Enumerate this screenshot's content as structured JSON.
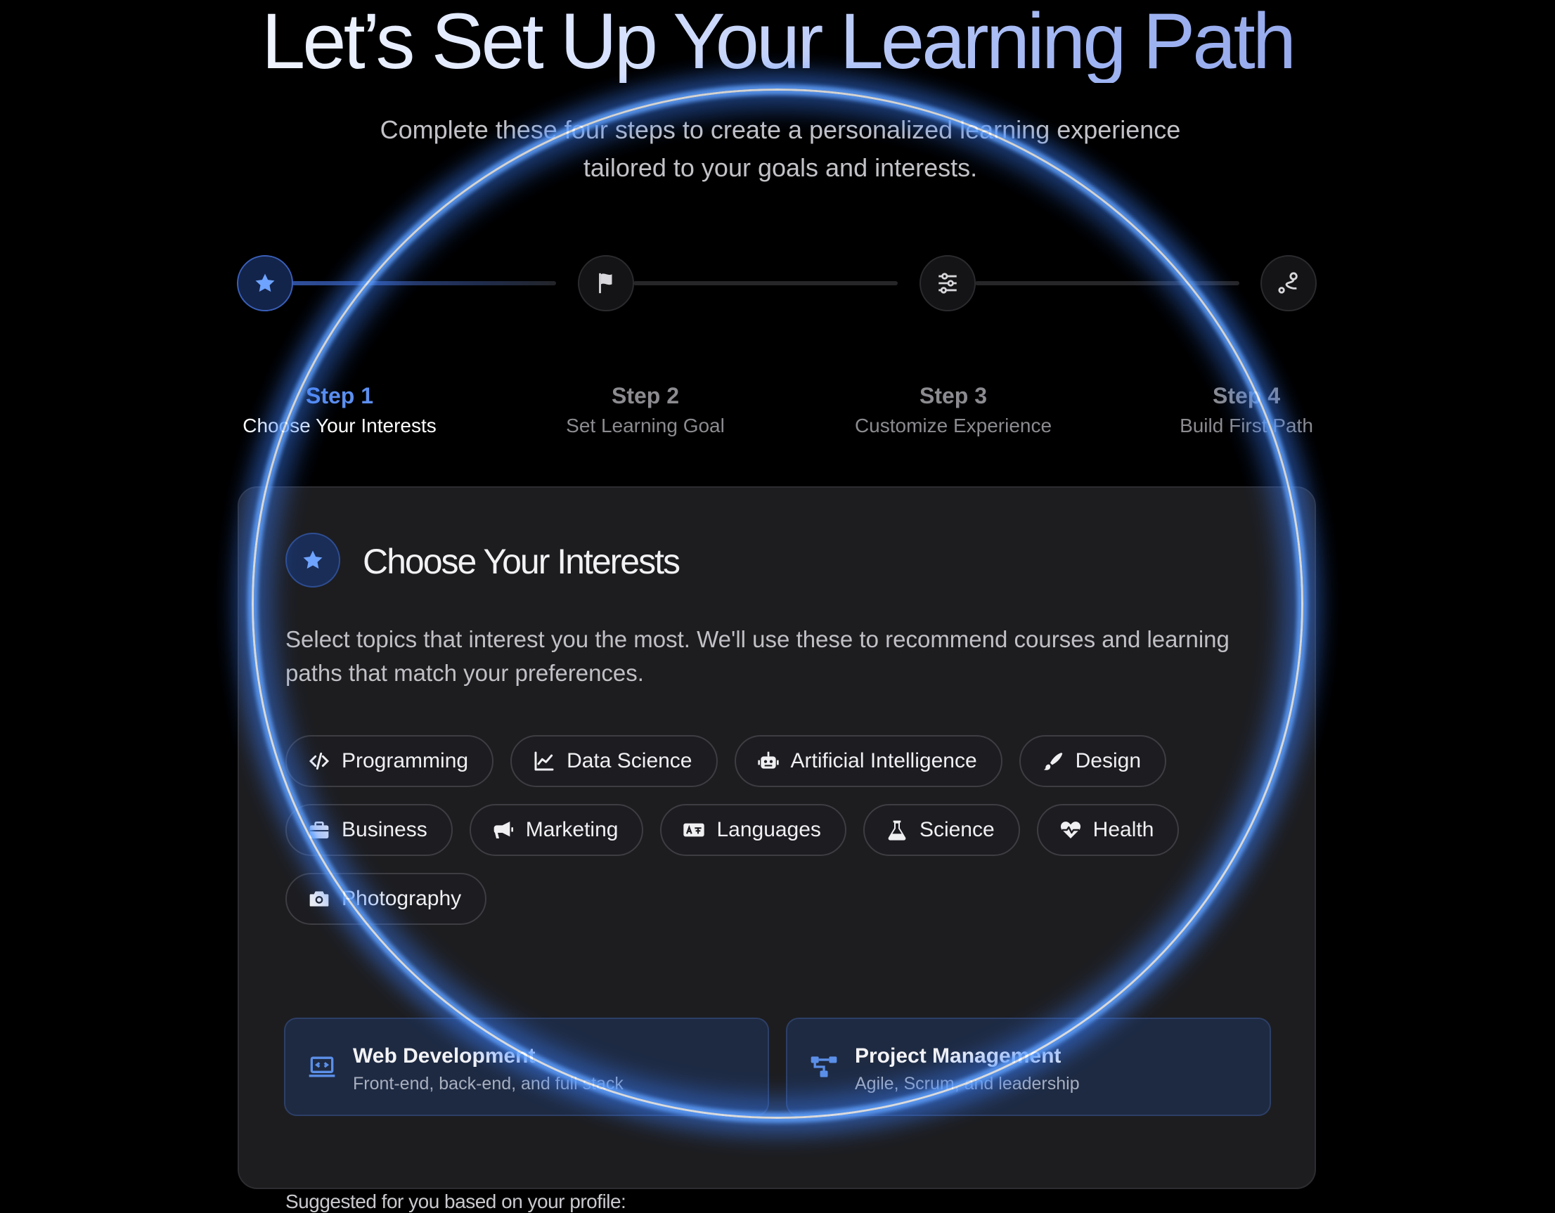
{
  "header": {
    "title": "Let’s Set Up Your Learning Path",
    "subtitle_line1": "Complete these four steps to create a personalized learning experience",
    "subtitle_line2": "tailored to your goals and interests."
  },
  "stepper": {
    "active_step": 1,
    "steps": [
      {
        "label": "Step 1",
        "sub": "Choose Your Interests",
        "icon": "star-icon"
      },
      {
        "label": "Step 2",
        "sub": "Set Learning Goal",
        "icon": "flag-icon"
      },
      {
        "label": "Step 3",
        "sub": "Customize Experience",
        "icon": "sliders-icon"
      },
      {
        "label": "Step 4",
        "sub": "Build First Path",
        "icon": "route-icon"
      }
    ]
  },
  "card": {
    "icon": "star-icon",
    "title": "Choose Your Interests",
    "description": "Select topics that interest you the most. We'll use these to recommend courses and learning paths that match your preferences.",
    "interests": [
      {
        "label": "Programming",
        "icon": "code-icon"
      },
      {
        "label": "Data Science",
        "icon": "chart-line-icon"
      },
      {
        "label": "Artificial Intelligence",
        "icon": "robot-icon"
      },
      {
        "label": "Design",
        "icon": "brush-icon"
      },
      {
        "label": "Business",
        "icon": "briefcase-icon"
      },
      {
        "label": "Marketing",
        "icon": "megaphone-icon"
      },
      {
        "label": "Languages",
        "icon": "language-icon"
      },
      {
        "label": "Science",
        "icon": "flask-icon"
      },
      {
        "label": "Health",
        "icon": "heart-pulse-icon"
      },
      {
        "label": "Photography",
        "icon": "camera-icon"
      }
    ],
    "suggested_label": "Suggested for you based on your profile:",
    "suggestions": [
      {
        "title": "Web Development",
        "sub": "Front-end, back-end, and full stack",
        "icon": "laptop-code-icon"
      },
      {
        "title": "Project Management",
        "sub": "Agile, Scrum, and leadership",
        "icon": "diagram-icon"
      }
    ]
  },
  "colors": {
    "accent": "#5d8ff0",
    "glow": "#3c82ff",
    "background": "#000000",
    "card": "#1d1d20"
  }
}
